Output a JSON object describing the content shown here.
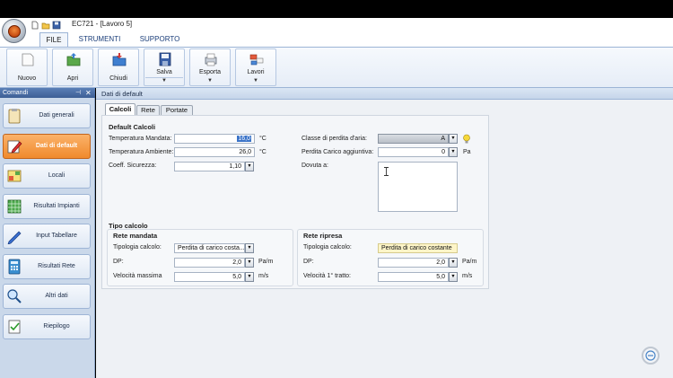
{
  "window": {
    "title": "EC721 - [Lavoro 5]"
  },
  "ribbon_tabs": [
    {
      "label": "FILE"
    },
    {
      "label": "STRUMENTI"
    },
    {
      "label": "SUPPORTO"
    }
  ],
  "ribbon_buttons": [
    {
      "label": "Nuovo"
    },
    {
      "label": "Apri"
    },
    {
      "label": "Chiudi"
    },
    {
      "label": "Salva"
    },
    {
      "label": "Esporta"
    },
    {
      "label": "Lavori"
    }
  ],
  "sidebar": {
    "title": "Comandi",
    "items": [
      {
        "label": "Dati generali"
      },
      {
        "label": "Dati di default"
      },
      {
        "label": "Locali"
      },
      {
        "label": "Risultati Impianti"
      },
      {
        "label": "Input Tabellare"
      },
      {
        "label": "Risultati Rete"
      },
      {
        "label": "Altri dati"
      },
      {
        "label": "Riepilogo"
      }
    ]
  },
  "main": {
    "header": "Dati di default",
    "tabs": [
      {
        "label": "Calcoli"
      },
      {
        "label": "Rete"
      },
      {
        "label": "Portate"
      }
    ],
    "default_calcoli": {
      "title": "Default Calcoli",
      "temp_mandata": {
        "label": "Temperatura Mandata:",
        "value": "16,0",
        "unit": "°C"
      },
      "temp_ambiente": {
        "label": "Temperatura Ambiente:",
        "value": "26,0",
        "unit": "°C"
      },
      "coeff_sicurezza": {
        "label": "Coeff. Sicurezza:",
        "value": "1,10"
      },
      "classe_perdita": {
        "label": "Classe di perdita d'aria:",
        "value": "A"
      },
      "perdita_carico": {
        "label": "Perdita Carico aggiuntiva:",
        "value": "0",
        "unit": "Pa"
      },
      "dovuta_a": {
        "label": "Dovuta a:"
      }
    },
    "tipo_calcolo": {
      "title": "Tipo calcolo",
      "rete_mandata": {
        "title": "Rete mandata",
        "tipologia": {
          "label": "Tipologia calcolo:",
          "value": "Perdita di carico costa..."
        },
        "dp": {
          "label": "DP:",
          "value": "2,0",
          "unit": "Pa/m"
        },
        "velocita": {
          "label": "Velocità massima",
          "value": "5,0",
          "unit": "m/s"
        }
      },
      "rete_ripresa": {
        "title": "Rete ripresa",
        "tipologia": {
          "label": "Tipologia calcolo:",
          "value": "Perdita di carico costante"
        },
        "dp": {
          "label": "DP:",
          "value": "2,0",
          "unit": "Pa/m"
        },
        "velocita": {
          "label": "Velocità 1° tratto:",
          "value": "5,0",
          "unit": "m/s"
        }
      }
    }
  }
}
